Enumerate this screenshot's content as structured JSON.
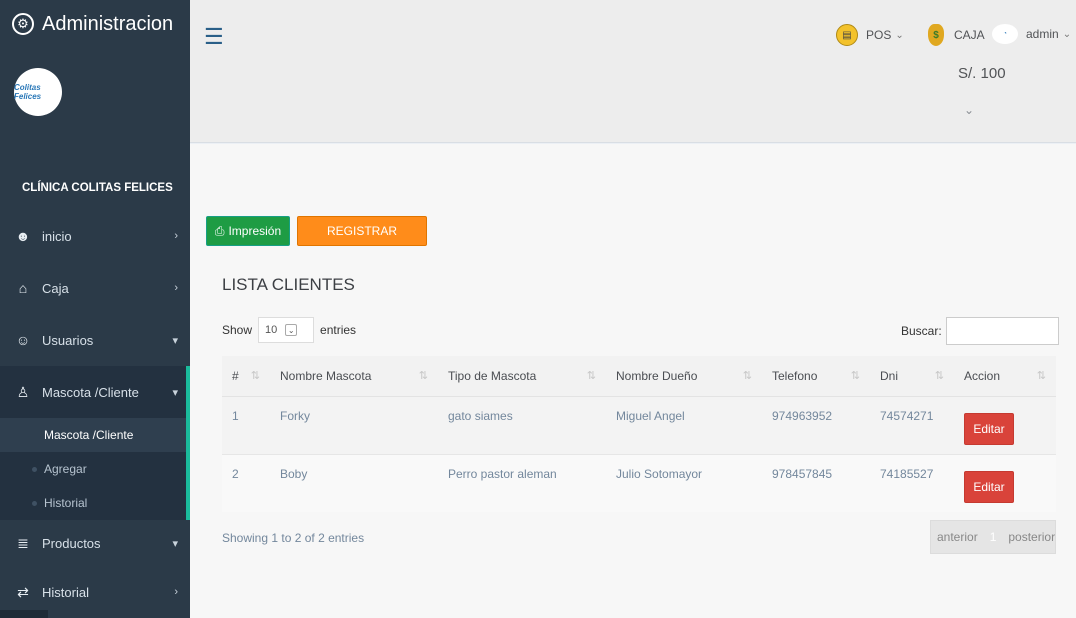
{
  "app": {
    "title": "Administracion",
    "clinic_name": "CLÍNICA COLITAS FELICES",
    "logo_text": "Colitas Felices"
  },
  "sidebar": {
    "items": [
      {
        "label": "inicio",
        "icon": "paw-icon",
        "arrow": "›"
      },
      {
        "label": "Caja",
        "icon": "bank-icon",
        "arrow": "›"
      },
      {
        "label": "Usuarios",
        "icon": "users-icon",
        "arrow": "⌄"
      },
      {
        "label": "Mascota /Cliente",
        "icon": "user-pet-icon",
        "arrow": "⌄"
      },
      {
        "label": "Productos",
        "icon": "database-icon",
        "arrow": "⌄"
      },
      {
        "label": "Historial",
        "icon": "exchange-icon",
        "arrow": "›"
      }
    ],
    "submenu": [
      {
        "label": "Mascota /Cliente"
      },
      {
        "label": "Agregar"
      },
      {
        "label": "Historial"
      }
    ]
  },
  "topbar": {
    "pos_label": "POS",
    "caja_label": "CAJA",
    "caja_amount": "S/. 100",
    "admin_label": "admin"
  },
  "content": {
    "print_label": "Impresión",
    "register_label": "REGISTRAR",
    "list_title": "LISTA CLIENTES",
    "show_label": "Show",
    "entries_value": "10",
    "entries_label": "entries",
    "search_label": "Buscar:",
    "search_value": "",
    "columns": [
      "#",
      "Nombre Mascota",
      "Tipo de Mascota",
      "Nombre Dueño",
      "Telefono",
      "Dni",
      "Accion"
    ],
    "rows": [
      {
        "num": "1",
        "pet": "Forky",
        "type": "gato siames",
        "owner": "Miguel Angel",
        "phone": "974963952",
        "dni": "74574271",
        "action": "Editar"
      },
      {
        "num": "2",
        "pet": "Boby",
        "type": "Perro pastor aleman",
        "owner": "Julio Sotomayor",
        "phone": "978457845",
        "dni": "74185527",
        "action": "Editar"
      }
    ],
    "info": "Showing 1 to 2 of 2 entries",
    "pager": {
      "prev": "anterior",
      "page": "1",
      "next": "posterior"
    }
  },
  "colors": {
    "sidebar_bg": "#2b3a48",
    "accent": "#1abb9c",
    "print_btn": "#1e9c44",
    "register_btn": "#ff8c1a",
    "edit_btn": "#d9433a"
  }
}
